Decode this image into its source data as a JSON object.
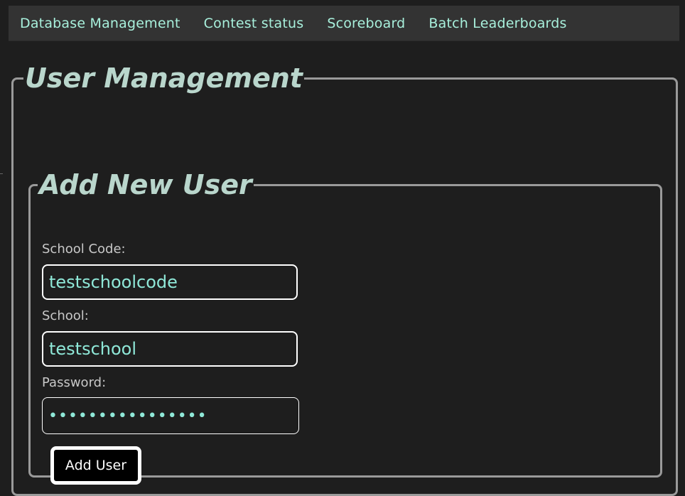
{
  "nav": {
    "items": [
      {
        "label": "Database Management"
      },
      {
        "label": "Contest status"
      },
      {
        "label": "Scoreboard"
      },
      {
        "label": "Batch Leaderboards"
      }
    ]
  },
  "user_management": {
    "title": "User Management",
    "add_user": {
      "title": "Add New User",
      "school_code_label": "School Code:",
      "school_code_value": "testschoolcode",
      "school_label": "School:",
      "school_value": "testschool",
      "password_label": "Password:",
      "password_value": "••••••••••••••••",
      "submit_label": "Add User"
    }
  },
  "colors": {
    "background": "#1e1e1e",
    "nav_background": "#333333",
    "accent_text": "#a8f0dc",
    "heading_text": "#b9d6cc",
    "border": "#9a9a9a"
  }
}
